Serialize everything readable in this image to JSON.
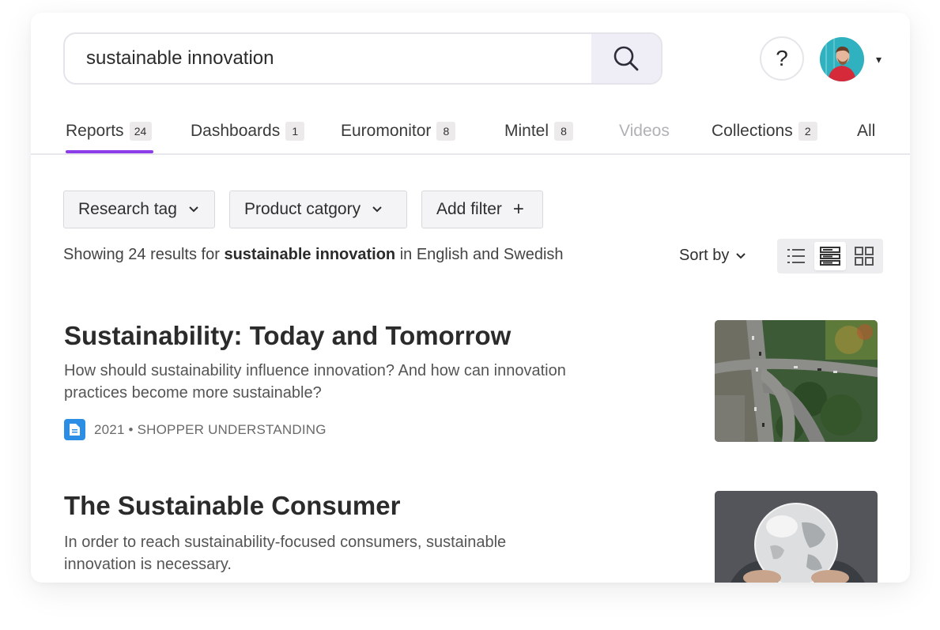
{
  "search": {
    "value": "sustainable innovation",
    "button_icon": "search-icon"
  },
  "header": {
    "help_label": "?",
    "avatar_icon": "user-avatar",
    "avatar_caret": "▾"
  },
  "tabs": [
    {
      "label": "Reports",
      "count": "24"
    },
    {
      "label": "Dashboards",
      "count": "1"
    },
    {
      "label": "Euromonitor",
      "count": "8"
    },
    {
      "label": "Mintel",
      "count": "8"
    },
    {
      "label": "Videos",
      "count": ""
    },
    {
      "label": "Collections",
      "count": "2"
    },
    {
      "label": "All",
      "count": ""
    }
  ],
  "filters": {
    "research_tag": "Research tag",
    "product_category": "Product catgory",
    "add_filter": "Add filter",
    "add_icon": "+"
  },
  "summary": {
    "prefix": "Showing 24 results for",
    "query": "sustainable innovation",
    "suffix": "in English and Swedish"
  },
  "sort": {
    "label": "Sort by"
  },
  "view_modes": [
    "list-view-icon",
    "card-list-view-icon",
    "grid-view-icon"
  ],
  "results": [
    {
      "title": "Sustainability: Today and Tomorrow",
      "description": "How should sustainability influence innovation? And how can innovation practices become more sustainable?",
      "meta": "2021 • SHOPPER UNDERSTANDING",
      "thumb": "aerial-road-junction-image"
    },
    {
      "title": "The Sustainable Consumer",
      "description": "In order to reach sustainability-focused consumers, sustainable innovation is necessary.",
      "thumb": "glass-globe-image"
    }
  ],
  "colors": {
    "accent": "#8b3ee8",
    "doc_icon": "#2b8de3",
    "search_button_bg": "#efeef6"
  }
}
